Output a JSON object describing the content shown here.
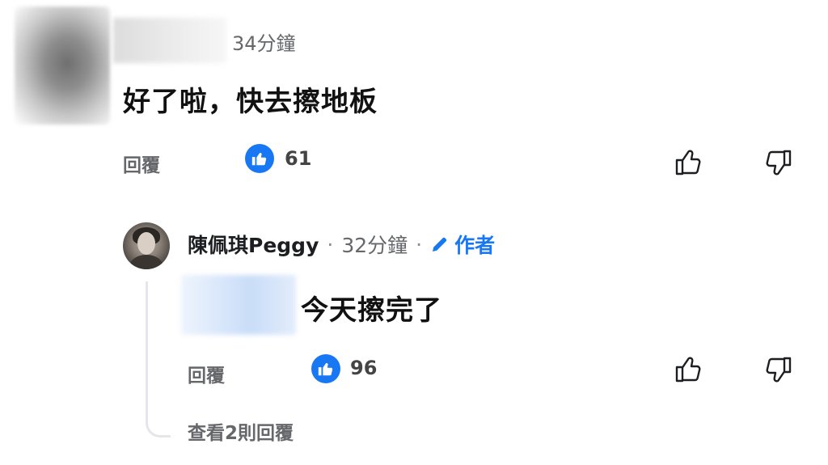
{
  "top_comment": {
    "time": "34分鐘",
    "text": "好了啦，快去擦地板",
    "reply_label": "回覆",
    "like_count": "61"
  },
  "reply_comment": {
    "author": "陳佩琪Peggy",
    "separator": "·",
    "time": "32分鐘",
    "author_badge": "作者",
    "text": "今天擦完了",
    "reply_label": "回覆",
    "like_count": "96",
    "view_replies": "查看2則回覆"
  },
  "icons": {
    "like_badge": "thumbs-up-icon",
    "like_action": "thumbs-up-outline-icon",
    "dislike_action": "thumbs-down-outline-icon",
    "author_badge": "pencil-icon"
  },
  "colors": {
    "accent": "#1877f2",
    "secondary_text": "#65676b",
    "thread_line": "#e4e6eb"
  }
}
